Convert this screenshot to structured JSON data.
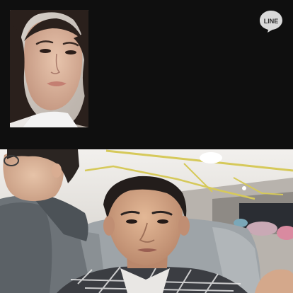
{
  "call": {
    "brand_logo": {
      "text": "LINE",
      "icon": "line-chat-bubble-icon",
      "color": "#d9d9d9"
    },
    "remote_video": {
      "icon": "remote-participant-video"
    },
    "local_video": {
      "icon": "self-camera-video"
    }
  },
  "colors": {
    "background": "#0f0f0f",
    "logo": "#d9d9d9"
  }
}
